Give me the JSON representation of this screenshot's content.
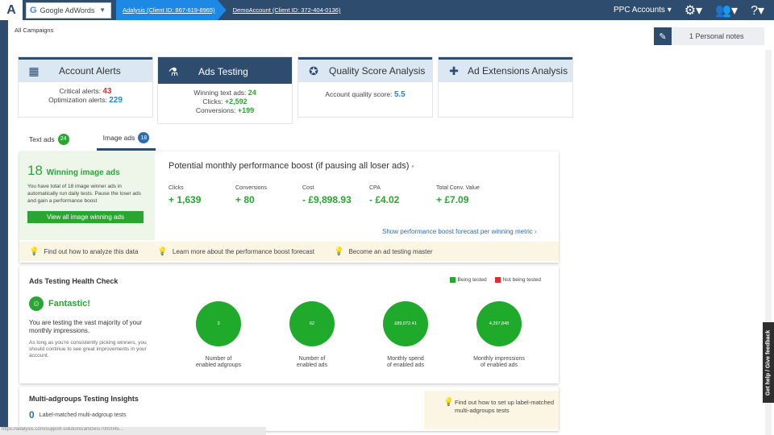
{
  "topbar": {
    "adwords_label": "Google AdWords",
    "crumb_analysis": "Adalysis (Client ID: 867-619-8965)",
    "crumb_account": "DemoAccount (Client ID: 372-404-0136)",
    "ppc_accounts": "PPC Accounts",
    "icons": [
      "gear-icon",
      "users-icon",
      "help-icon"
    ]
  },
  "breadcrumb": {
    "all_campaigns": "All Campaigns"
  },
  "notes": {
    "label": "1 Personal notes"
  },
  "cards": {
    "alerts": {
      "title": "Account Alerts",
      "critical_label": "Critical alerts:",
      "critical_value": "43",
      "optimization_label": "Optimization alerts:",
      "optimization_value": "229"
    },
    "testing": {
      "title": "Ads Testing",
      "winning_label": "Winning text ads:",
      "winning_value": "24",
      "clicks_label": "Clicks:",
      "clicks_value": "+2,592",
      "conv_label": "Conversions:",
      "conv_value": "+199"
    },
    "quality": {
      "title": "Quality Score Analysis",
      "label": "Account quality score:",
      "value": "5.5"
    },
    "extensions": {
      "title": "Ad Extensions Analysis"
    }
  },
  "tabs": [
    {
      "label": "Text ads",
      "count": "24",
      "color": "#2aa533"
    },
    {
      "label": "Image ads",
      "count": "18",
      "color": "#2b6cb0"
    }
  ],
  "winners": {
    "count": "18",
    "title": "Winning image ads",
    "desc": "You have total of 18 image winner ads in automatically run daily tests. Pause the loser ads and gain a performance boost",
    "button": "View all image winning ads"
  },
  "boost": {
    "title": "Potential monthly performance boost (if pausing all loser ads)",
    "metrics": [
      {
        "label": "Clicks",
        "value": "+ 1,639"
      },
      {
        "label": "Conversions",
        "value": "+ 80"
      },
      {
        "label": "Cost",
        "value": "- £9,898.93"
      },
      {
        "label": "CPA",
        "value": "- £4.02"
      },
      {
        "label": "Total Conv. Value",
        "value": "+ £7.09"
      }
    ],
    "link": "Show performance boost forecast per winning metric"
  },
  "tips": [
    "Find out how to analyze this data",
    "Learn more about the performance boost forecast",
    "Become an ad testing master"
  ],
  "health": {
    "title": "Ads Testing Health Check",
    "legend": [
      {
        "label": "Being tested",
        "color": "#1faa2c"
      },
      {
        "label": "Not being tested",
        "color": "#d9302c"
      }
    ],
    "status": "Fantastic!",
    "desc": "You are testing the vast majority of your monthly impressions.",
    "sub": "As long as you're consistently picking winners, you should continue to see great improvements in your account.",
    "circles": [
      {
        "value": "3",
        "label1": "Number of",
        "label2": "enabled adgroups"
      },
      {
        "value": "62",
        "label1": "Number of",
        "label2": "enabled ads"
      },
      {
        "value": "£89,072.41",
        "label1": "Monthly spend",
        "label2": "of enabled ads"
      },
      {
        "value": "4,297,848",
        "label1": "Monthly impressions",
        "label2": "of enabled ads"
      }
    ]
  },
  "insights": {
    "title": "Multi-adgroups Testing Insights",
    "count": "0",
    "count_label": "Label-matched multi-adgroup tests",
    "tip": "Find out how to set up label-matched multi-adgroups tests"
  },
  "feedback": "Get help / Give feedback",
  "statusbar": "https://adalysis.com/support-solutions/articles/7000045..."
}
